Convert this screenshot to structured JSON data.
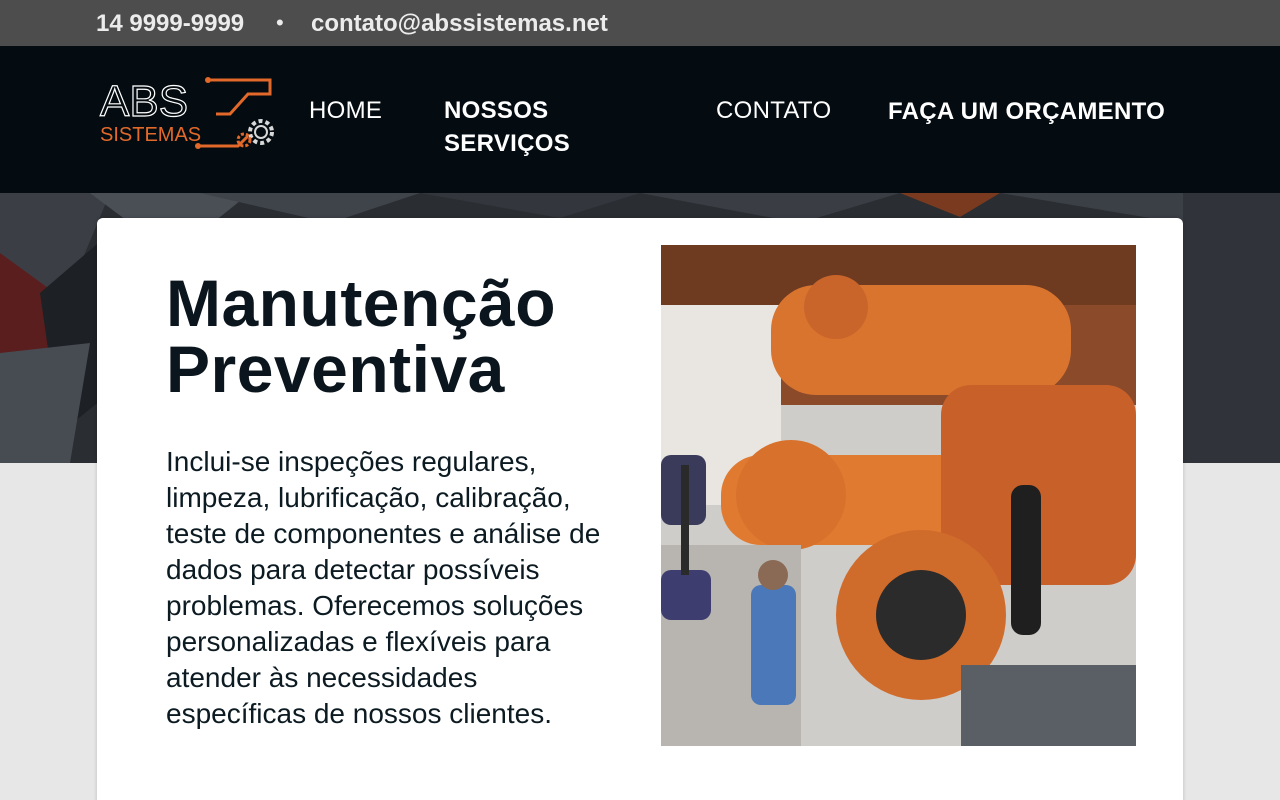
{
  "topbar": {
    "phone": "14 9999-9999",
    "separator": "•",
    "email": "contato@abssistemas.net"
  },
  "logo": {
    "text_main": "ABS",
    "text_sub": "SISTEMAS"
  },
  "nav": {
    "home": "HOME",
    "servicos": "NOSSOS SERVIÇOS",
    "contato": "CONTATO",
    "orcamento": "FAÇA UM ORÇAMENTO"
  },
  "content": {
    "title": "Manutenção Preventiva",
    "description": "Inclui-se inspeções regulares, limpeza, lubrificação, calibração, teste de componentes e análise de dados para detectar possíveis problemas. Oferecemos soluções personalizadas e flexíveis para atender às necessidades específicas de nossos clientes."
  },
  "colors": {
    "topbar_bg": "#4d4d4d",
    "navbar_bg": "#040c11",
    "brand_orange": "#e2692a",
    "page_bg": "#e7e7e7"
  },
  "icons": {
    "logo_gear": "gear-icon"
  }
}
